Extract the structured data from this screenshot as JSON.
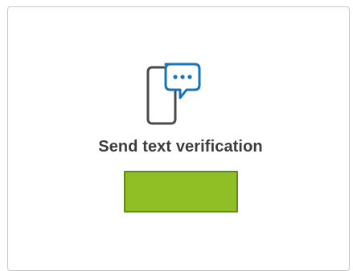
{
  "verification": {
    "label": "Send text verification",
    "button_label": "",
    "icon": "phone-chat-icon"
  },
  "colors": {
    "button_fill": "#8fbf24",
    "button_border": "#5e8a17",
    "icon_phone": "#4a4a4a",
    "icon_bubble": "#1a73b8",
    "text": "#3c3c3c"
  }
}
